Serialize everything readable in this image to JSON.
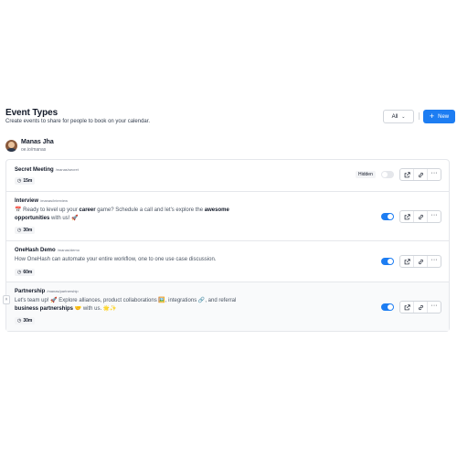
{
  "header": {
    "title": "Event Types",
    "subtitle": "Create events to share for people to book on your calendar.",
    "filter_label": "All",
    "new_label": "New"
  },
  "profile": {
    "name": "Manas Jha",
    "handle": "oe.io/manas"
  },
  "events": [
    {
      "title": "Secret Meeting",
      "slug": "/manas/secret",
      "duration": "15m",
      "hidden_label": "Hidden",
      "enabled": false
    },
    {
      "title": "Interview",
      "slug": "/manas/interview",
      "desc_1": "📅 Ready to level up your ",
      "desc_b1": "career",
      "desc_2": " game? Schedule a call and let's explore the ",
      "desc_b2": "awesome opportunities",
      "desc_3": " with us! 🚀",
      "duration": "30m",
      "enabled": true
    },
    {
      "title": "OneHash Demo",
      "slug": "/manas/demo",
      "desc_1": "How OneHash can automate your entire workflow, one to one use case discussion.",
      "duration": "60m",
      "enabled": true
    },
    {
      "title": "Partnership",
      "slug": "/manas/partnership",
      "desc_1": "Let's team up! 🚀 Explore alliances, product collaborations 🖼️, integrations 🔗, and referral ",
      "desc_b1": "business partnerships",
      "desc_2": " 🤝 with us. 🌟✨",
      "duration": "30m",
      "enabled": true
    }
  ],
  "colors": {
    "accent": "#1d7df2",
    "border": "#e5e7eb"
  },
  "icons": {
    "filter": "chevron-down-icon",
    "new": "plus-icon",
    "duration": "clock-icon",
    "preview": "external-link-icon",
    "copy": "link-icon",
    "more": "more-horizontal-icon"
  }
}
